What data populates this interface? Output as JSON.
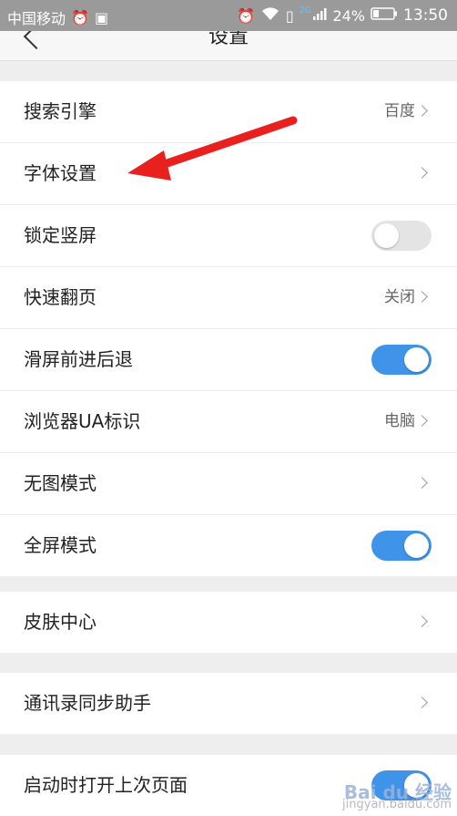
{
  "status_bar": {
    "carrier": "中国移动",
    "network": "2G",
    "battery": "24%",
    "time": "13:50"
  },
  "header": {
    "title": "设置"
  },
  "group1": [
    {
      "label": "搜索引擎",
      "value": "百度",
      "control": "chevron"
    },
    {
      "label": "字体设置",
      "value": "",
      "control": "chevron"
    },
    {
      "label": "锁定竖屏",
      "control": "toggle",
      "on": false
    },
    {
      "label": "快速翻页",
      "value": "关闭",
      "control": "chevron"
    },
    {
      "label": "滑屏前进后退",
      "control": "toggle",
      "on": true
    },
    {
      "label": "浏览器UA标识",
      "value": "电脑",
      "control": "chevron"
    },
    {
      "label": "无图模式",
      "value": "",
      "control": "chevron"
    },
    {
      "label": "全屏模式",
      "control": "toggle",
      "on": true
    }
  ],
  "group2": [
    {
      "label": "皮肤中心",
      "value": "",
      "control": "chevron"
    }
  ],
  "group3": [
    {
      "label": "通讯录同步助手",
      "value": "",
      "control": "chevron"
    }
  ],
  "group4": [
    {
      "label": "启动时打开上次页面",
      "control": "toggle",
      "on": true
    }
  ],
  "watermark": {
    "brand": "Bai du 经验",
    "url": "jingyan.baidu.com"
  },
  "colors": {
    "toggle_on": "#3f93e9",
    "toggle_off": "#e4e4e4",
    "annotation_arrow": "#e8201e"
  }
}
